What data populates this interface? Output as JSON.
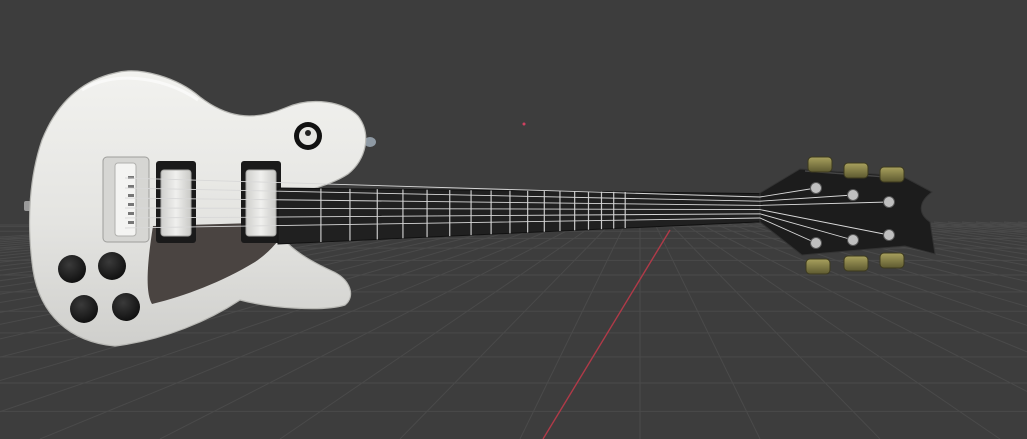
{
  "viewport": {
    "background_color": "#3d3d3d",
    "grid_color": "#4a4a4a",
    "x_axis_color": "#b03a48"
  },
  "model": {
    "object": "electric guitar",
    "body_color": "#e6e6e3",
    "pickguard_color": "#4a4441",
    "fretboard_color": "#202020",
    "fret_color": "#c8c8c8",
    "headstock_color": "#1c1c1c",
    "tuner_color": "#8a8348",
    "knob_color": "#171717",
    "fret_count": 17,
    "string_count": 6,
    "knob_count": 4,
    "pickup_count": 2
  }
}
